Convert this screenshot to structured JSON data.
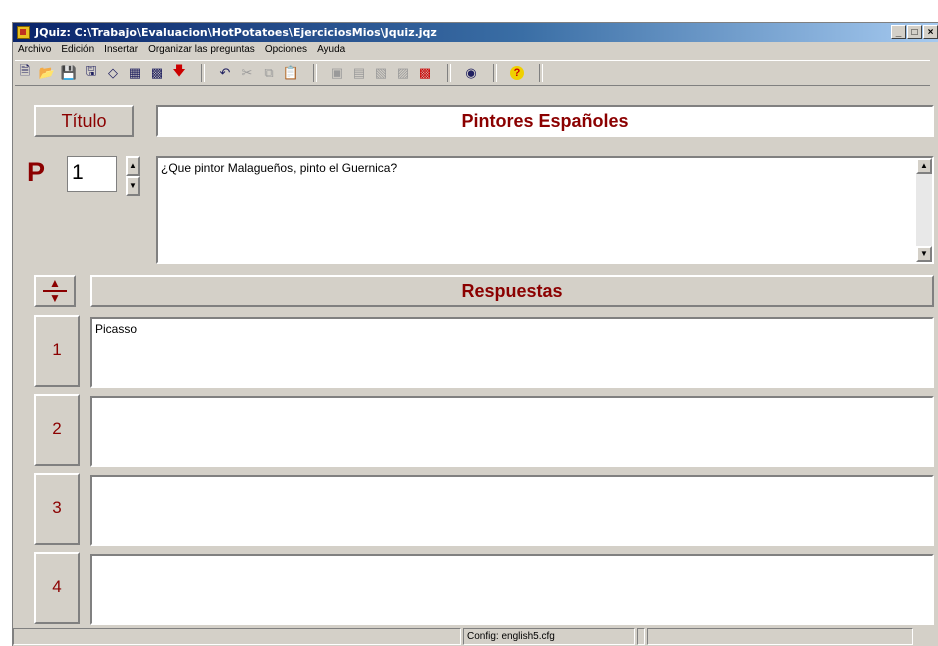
{
  "window": {
    "title": "JQuiz: C:\\Trabajo\\Evaluacion\\HotPotatoes\\EjerciciosMios\\Jquiz.jqz",
    "controls": [
      "_",
      "□",
      "×"
    ]
  },
  "menu": [
    "Archivo",
    "Edición",
    "Insertar",
    "Organizar las preguntas",
    "Opciones",
    "Ayuda"
  ],
  "toolbar": {
    "groups": [
      [
        "new-icon",
        "open-icon",
        "save-icon",
        "save-as-icon",
        "clear-icon",
        "web-page-icon",
        "web-page-2-icon",
        "down-arrow-icon"
      ],
      [
        "undo-icon",
        "cut-icon",
        "copy-icon",
        "paste-icon"
      ],
      [
        "insert-picture-icon",
        "insert-link-icon",
        "insert-table-icon",
        "insert-media-icon",
        "insert-feedback-icon"
      ],
      [
        "config-icon"
      ],
      [
        "help-icon"
      ]
    ]
  },
  "titulo": {
    "label": "Título",
    "value": "Pintores Españoles"
  },
  "question": {
    "prefix": "P",
    "number": "1",
    "text": "¿Que pintor Malagueños, pinto el Guernica?"
  },
  "answers": {
    "header": "Respuestas",
    "items": [
      {
        "number": "1",
        "text": "Picasso"
      },
      {
        "number": "2",
        "text": ""
      },
      {
        "number": "3",
        "text": ""
      },
      {
        "number": "4",
        "text": ""
      }
    ]
  },
  "status": {
    "config": "Config: english5.cfg"
  },
  "colors": {
    "label_red": "#8b0000",
    "face": "#d4d0c8",
    "title_blue": "#0a246a"
  }
}
